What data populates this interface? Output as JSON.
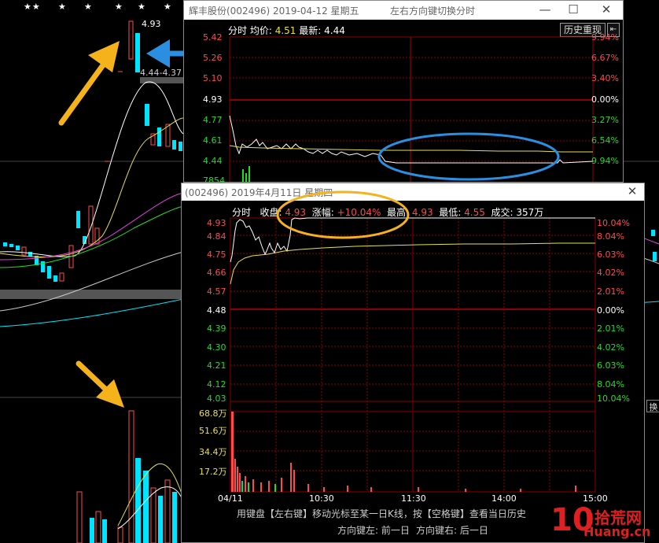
{
  "background": {
    "stars": [
      "★★",
      "★",
      "★",
      "★",
      "★",
      "★"
    ],
    "peak_label": "4.93",
    "range_label": "4.44-4.37",
    "side_button": "换"
  },
  "window1": {
    "title": "辉丰股份(002496) 2019-04-12 星期五",
    "hint": "左右方向键切换分时",
    "controls": {
      "minimize": "—",
      "maximize": "☐",
      "close": "✕"
    },
    "header": {
      "mode": "分时",
      "avg_label": "均价:",
      "avg_value": "4.51",
      "latest_label": "最新:",
      "latest_value": "4.44"
    },
    "history_button": "历史重现",
    "back_button": "⇤",
    "price_ticks": [
      "5.42",
      "5.26",
      "5.10",
      "4.93",
      "4.77",
      "4.61",
      "4.44"
    ],
    "pct_ticks": [
      "9.94%",
      "6.67%",
      "3.40%",
      "0.00%",
      "3.27%",
      "6.54%",
      "9.94%"
    ],
    "partial_label": "7854"
  },
  "window2": {
    "title": "(002496) 2019年4月11日 星期四",
    "close_icon": "✕",
    "header": {
      "mode": "分时",
      "close_label": "收盘:",
      "close_value": "4.93",
      "change_label": "涨幅:",
      "change_value": "+10.04%",
      "high_label": "最高:",
      "high_value": "4.93",
      "low_label": "最低:",
      "low_value": "4.55",
      "vol_label": "成交:",
      "vol_value": "357万"
    },
    "price_ticks": [
      "4.93",
      "4.84",
      "4.75",
      "4.66",
      "4.57",
      "4.48",
      "4.39",
      "4.30",
      "4.21",
      "4.12",
      "4.03"
    ],
    "pct_ticks": [
      "10.04%",
      "8.04%",
      "6.03%",
      "4.02%",
      "2.01%",
      "0.00%",
      "2.01%",
      "4.02%",
      "6.03%",
      "8.04%",
      "10.04%"
    ],
    "volume_ticks": [
      "68.8万",
      "51.6万",
      "34.4万",
      "17.2万"
    ],
    "time_ticks": [
      "04/11",
      "10:30",
      "11:30",
      "14:00",
      "15:00"
    ],
    "hint_line1": "用键盘【左右键】移动光标至某一日K线，按【空格键】查看当日历史",
    "hint_line2_left": "方向键左: 前一日",
    "hint_line2_right": "方向键右: 后一日"
  },
  "watermark": {
    "number": "10",
    "text": "拾荒网",
    "domain": "Huang.cn"
  },
  "colors": {
    "up": "#ff4b4b",
    "down": "#22dd22",
    "cyan": "#00e5ff",
    "annotation_orange": "#f5b21b",
    "annotation_blue": "#2a8fe0"
  }
}
